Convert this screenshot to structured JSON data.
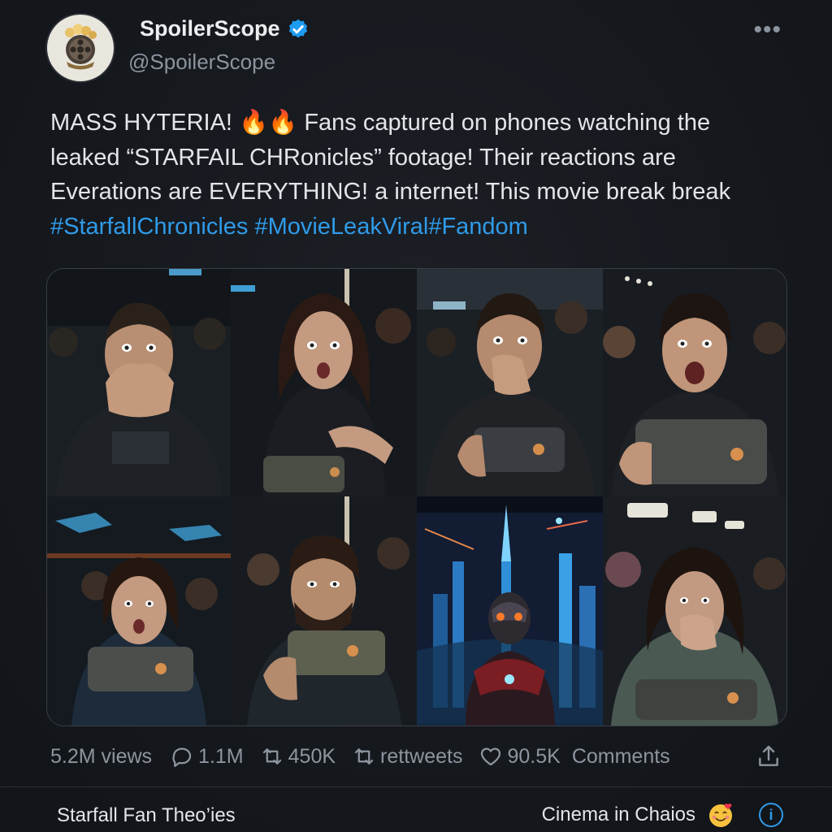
{
  "account": {
    "display_name": "SpoilerScope",
    "handle": "@SpoilerScope"
  },
  "menu": {
    "more_label": "•••"
  },
  "tweet": {
    "line1_a": "MASS HYTERIA! ",
    "line1_emoji": "🔥🔥",
    "line1_b": " Fans captured on phones watching the",
    "line2": "leaked “STARFAIL CHRonicles” footage! Their reactions are",
    "line3": "Everations are EVERYTHING! a internet! This movie break break",
    "hashtags": [
      "#StarfallChronicles",
      " #MovieLeakViral",
      "#Fandom"
    ]
  },
  "media": {
    "tiles": [
      "fan-covering-mouth",
      "woman-pointing-at-phone",
      "man-hand-over-mouth-phone",
      "man-screaming-phone",
      "woman-shocked-phone",
      "bearded-man-phone",
      "armored-robot-city",
      "woman-hand-over-mouth"
    ]
  },
  "stats": {
    "views": "5.2M views",
    "replies": "1.1M",
    "retweets": "450K",
    "retweets_label": "rettweets",
    "likes": "90.5K",
    "comments_label": "Comments"
  },
  "footer": {
    "left_link": "Starfall Fan Theo’ies",
    "right_link": "Cinema in Chaios",
    "info_label": "i"
  },
  "colors": {
    "background": "#15181d",
    "hashtag": "#2f9be9",
    "verified": "#1d9bf0",
    "muted": "#8e959e"
  }
}
